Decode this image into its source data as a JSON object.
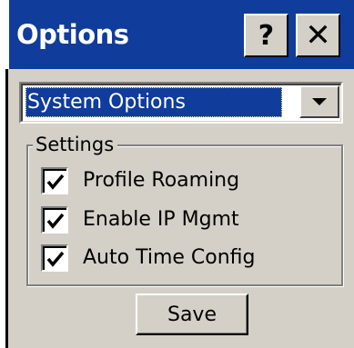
{
  "window": {
    "title": "Options",
    "help_label": "?",
    "close_label": "✕"
  },
  "selector": {
    "value": "System Options"
  },
  "settings": {
    "group_label": "Settings",
    "items": [
      {
        "label": "Profile Roaming",
        "checked": true
      },
      {
        "label": "Enable IP Mgmt",
        "checked": true
      },
      {
        "label": "Auto Time Config",
        "checked": true
      }
    ]
  },
  "actions": {
    "save_label": "Save"
  },
  "colors": {
    "titlebar": "#103c9c",
    "face": "#d4d0c8",
    "selection": "#103c9c"
  }
}
